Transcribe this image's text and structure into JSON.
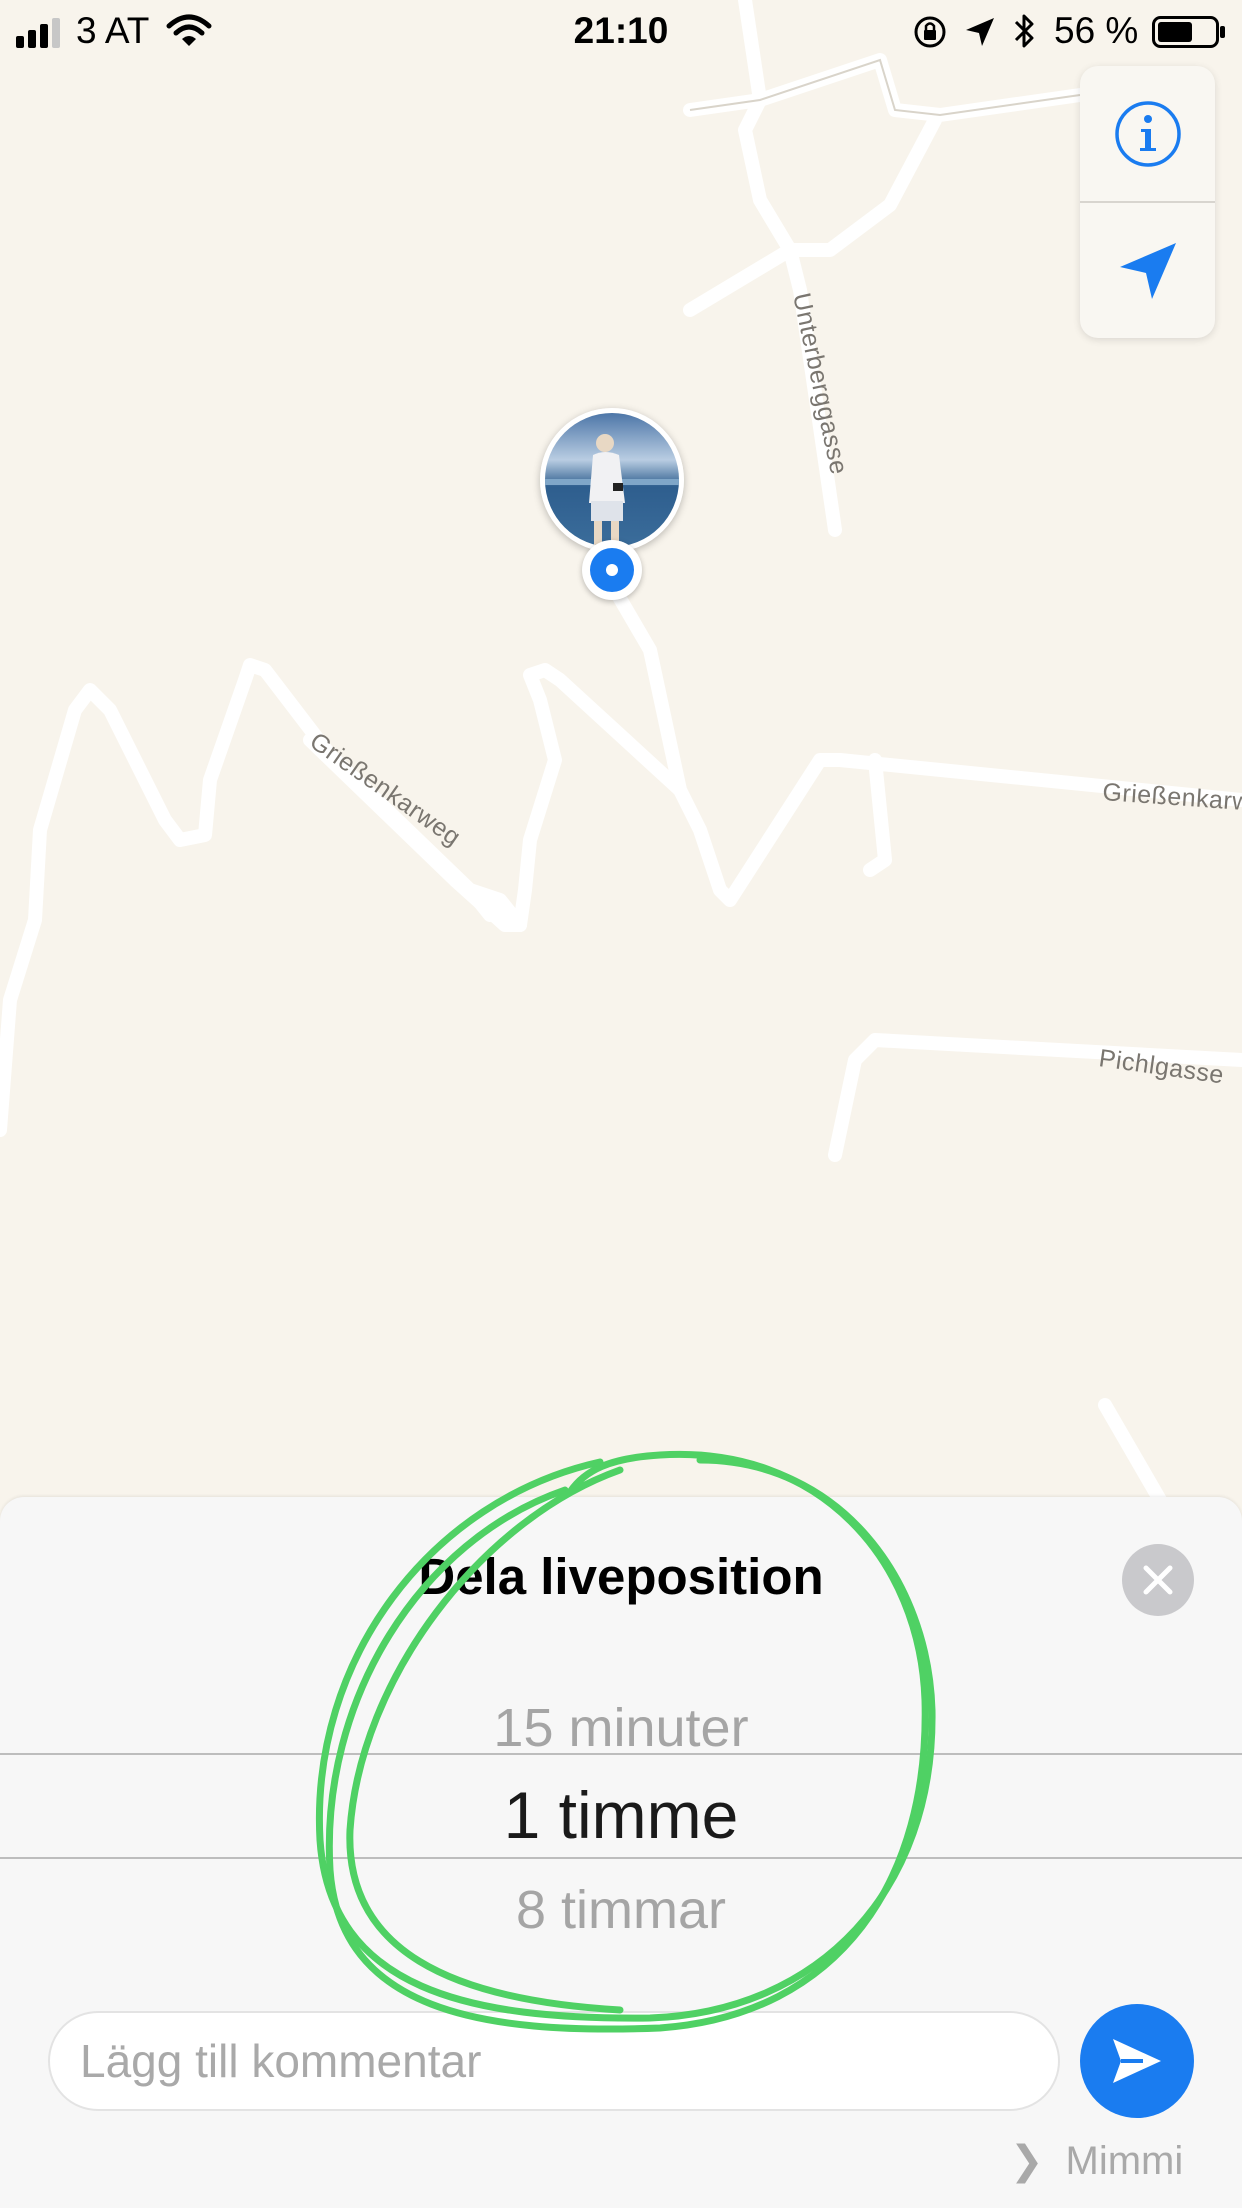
{
  "status_bar": {
    "carrier": "3 AT",
    "time": "21:10",
    "battery": "56 %"
  },
  "map": {
    "road_labels": {
      "unterberggasse": "Unterberggasse",
      "griessenkarweg": "Grießenkarweg",
      "griessenkarw_right": "Grießenkarw",
      "pichlgasse": "Pichlgasse"
    }
  },
  "map_controls": {
    "info_icon": "info-icon",
    "location_icon": "location-arrow-icon"
  },
  "share_sheet": {
    "title": "Dela liveposition",
    "options": [
      "15 minuter",
      "1 timme",
      "8 timmar"
    ],
    "selected": "1 timme",
    "comment_placeholder": "Lägg till kommentar",
    "recipient": "Mimmi"
  },
  "colors": {
    "accent": "#1a7cf0",
    "annotation": "#4fd164",
    "map_background": "#f8f4ec"
  }
}
